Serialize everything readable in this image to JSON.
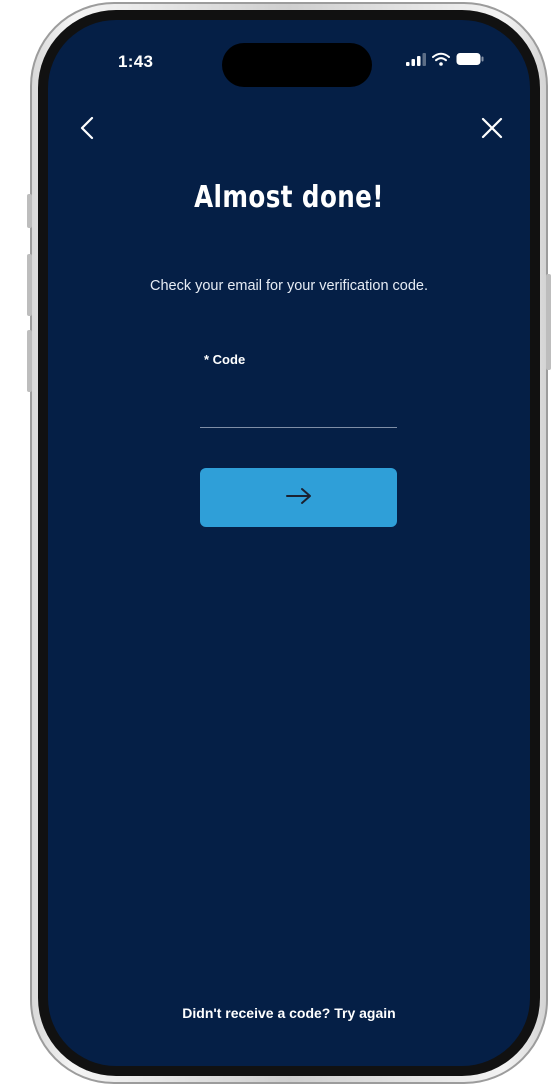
{
  "status_bar": {
    "time": "1:43",
    "icons": [
      "signal-icon",
      "wifi-icon",
      "battery-icon"
    ]
  },
  "nav": {
    "back_icon": "chevron-left-icon",
    "close_icon": "close-icon"
  },
  "page": {
    "title": "Almost done!",
    "subtitle": "Check your email for your verification code."
  },
  "form": {
    "code_label": "* Code",
    "code_value": "",
    "submit_icon": "arrow-right-icon"
  },
  "footer": {
    "prompt": "Didn't receive a code?",
    "link": "Try again"
  },
  "colors": {
    "background": "#051f46",
    "accent": "#2f9fd8",
    "text": "#ffffff"
  }
}
